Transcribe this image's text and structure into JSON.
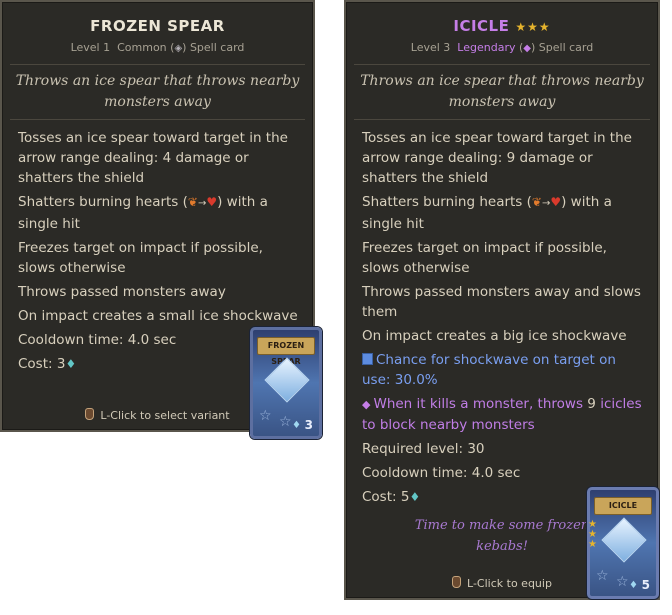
{
  "left": {
    "title": "FROZEN SPEAR",
    "level": "Level 1",
    "rarity": "Common",
    "type": "Spell card",
    "description": "Throws an ice spear that throws nearby monsters away",
    "line1": "Tosses an ice spear toward target in the arrow range dealing: 4 damage or shatters the shield",
    "line2_pre": "Shatters burning hearts (",
    "line2_post": ") with a single hit",
    "line3": "Freezes target on impact if possible, slows otherwise",
    "line4": "Throws passed monsters away",
    "line5": "On impact creates a small ice shockwave",
    "cooldown": "Cooldown time: 4.0 sec",
    "cost": "Cost: 3",
    "footer": "L-Click to select variant",
    "card_title": "FROZEN SPEAR",
    "card_cost": "3"
  },
  "right": {
    "title": "ICICLE",
    "stars": "★★★",
    "level": "Level 3",
    "rarity": "Legendary",
    "type": "Spell card",
    "description": "Throws an ice spear that throws nearby monsters away",
    "line1": "Tosses an ice spear toward target in the arrow range dealing: 9 damage or shatters the shield",
    "line2_pre": "Shatters burning hearts (",
    "line2_post": ") with a single hit",
    "line3": "Freezes target on impact if possible, slows otherwise",
    "line4": "Throws passed monsters away and slows them",
    "line5": "On impact creates a big ice shockwave",
    "line6": "Chance for shockwave on target on use: 30.0%",
    "line7_a": "When it kills a monster, throws",
    "line7_num": "9",
    "line7_b": "icicles to block nearby monsters",
    "required": "Required level: 30",
    "cooldown": "Cooldown time: 4.0 sec",
    "cost": "Cost: 5",
    "flavor": "Time to make some frozen kebabs!",
    "footer": "L-Click to equip",
    "card_title": "ICICLE",
    "card_cost": "5"
  },
  "icons": {
    "heart": "heart-icon",
    "fire_heart": "burning-heart-icon",
    "mana": "mana-crystal-icon",
    "mouse": "mouse-left-click-icon"
  },
  "colors": {
    "legendary": "#c57ee7",
    "mana": "#62c6c6",
    "text": "#d8d0bd"
  }
}
